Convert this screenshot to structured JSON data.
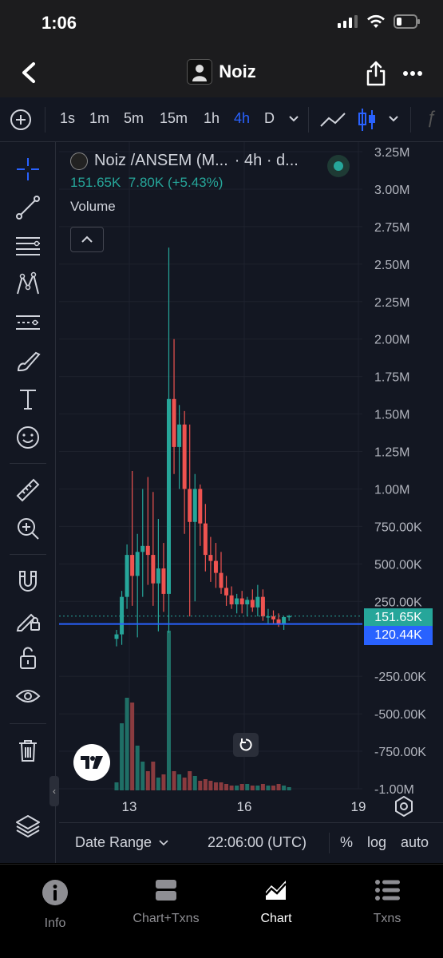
{
  "status": {
    "time": "1:06"
  },
  "nav": {
    "title": "Noiz",
    "back_icon": "chevron-left-icon",
    "share_icon": "share-icon",
    "more_icon": "more-icon"
  },
  "toolbar": {
    "intervals": [
      "1s",
      "1m",
      "5m",
      "15m",
      "1h",
      "4h",
      "D"
    ],
    "active_interval": "4h"
  },
  "legend": {
    "symbol": "Noiz /ANSEM (M...",
    "interval": "· 4h · d...",
    "price": "151.65K",
    "change": "7.80K (+5.43%)",
    "indicator": "Volume"
  },
  "price_axis": [
    "3.25M",
    "3.00M",
    "2.75M",
    "2.50M",
    "2.25M",
    "2.00M",
    "1.75M",
    "1.50M",
    "1.25M",
    "1.00M",
    "750.00K",
    "500.00K",
    "250.00K",
    "-250.00K",
    "-500.00K",
    "-750.00K",
    "-1.00M"
  ],
  "time_axis": [
    "13",
    "16",
    "19"
  ],
  "labels": {
    "current_price": "151.65K",
    "crosshair_price": "120.44K",
    "date_range": "Date Range",
    "utc_time": "22:06:00 (UTC)",
    "percent": "%",
    "log": "log",
    "auto": "auto"
  },
  "tabs": [
    {
      "label": "Info",
      "icon": "info-icon"
    },
    {
      "label": "Chart+Txns",
      "icon": "chart-txns-icon"
    },
    {
      "label": "Chart",
      "icon": "chart-icon",
      "active": true
    },
    {
      "label": "Txns",
      "icon": "list-icon"
    }
  ],
  "colors": {
    "up": "#26a69a",
    "down": "#ef5350",
    "accent": "#2962ff",
    "bg": "#131722"
  },
  "chart_data": {
    "type": "candlestick",
    "interval": "4h",
    "candles": [
      {
        "o": 0,
        "h": 60,
        "l": -50,
        "c": 30
      },
      {
        "o": 30,
        "h": 320,
        "l": -40,
        "c": 280
      },
      {
        "o": 280,
        "h": 630,
        "l": 200,
        "c": 560
      },
      {
        "o": 560,
        "h": 1120,
        "l": 220,
        "c": 420
      },
      {
        "o": 420,
        "h": 700,
        "l": 10,
        "c": 580
      },
      {
        "o": 580,
        "h": 1000,
        "l": 280,
        "c": 620
      },
      {
        "o": 620,
        "h": 1080,
        "l": 360,
        "c": 560
      },
      {
        "o": 560,
        "h": 980,
        "l": 220,
        "c": 370
      },
      {
        "o": 370,
        "h": 800,
        "l": 50,
        "c": 470
      },
      {
        "o": 470,
        "h": 640,
        "l": 180,
        "c": 300
      },
      {
        "o": 300,
        "h": 2610,
        "l": 40,
        "c": 1600
      },
      {
        "o": 1600,
        "h": 2000,
        "l": 1100,
        "c": 1280
      },
      {
        "o": 1280,
        "h": 1560,
        "l": 1000,
        "c": 1430
      },
      {
        "o": 1430,
        "h": 1520,
        "l": 700,
        "c": 1000
      },
      {
        "o": 1000,
        "h": 1430,
        "l": 150,
        "c": 780
      },
      {
        "o": 780,
        "h": 1100,
        "l": 250,
        "c": 1000
      },
      {
        "o": 1000,
        "h": 1030,
        "l": 620,
        "c": 770
      },
      {
        "o": 770,
        "h": 900,
        "l": 450,
        "c": 560
      },
      {
        "o": 560,
        "h": 680,
        "l": 380,
        "c": 520
      },
      {
        "o": 520,
        "h": 640,
        "l": 340,
        "c": 440
      },
      {
        "o": 440,
        "h": 580,
        "l": 300,
        "c": 340
      },
      {
        "o": 340,
        "h": 420,
        "l": 220,
        "c": 290
      },
      {
        "o": 290,
        "h": 350,
        "l": 200,
        "c": 230
      },
      {
        "o": 230,
        "h": 300,
        "l": 170,
        "c": 270
      },
      {
        "o": 270,
        "h": 320,
        "l": 170,
        "c": 230
      },
      {
        "o": 230,
        "h": 280,
        "l": 150,
        "c": 260
      },
      {
        "o": 260,
        "h": 330,
        "l": 180,
        "c": 210
      },
      {
        "o": 210,
        "h": 360,
        "l": 150,
        "c": 280
      },
      {
        "o": 280,
        "h": 330,
        "l": 120,
        "c": 150
      },
      {
        "o": 150,
        "h": 200,
        "l": 100,
        "c": 150
      },
      {
        "o": 150,
        "h": 190,
        "l": 100,
        "c": 130
      },
      {
        "o": 130,
        "h": 170,
        "l": 80,
        "c": 100
      },
      {
        "o": 100,
        "h": 150,
        "l": 60,
        "c": 145
      },
      {
        "o": 145,
        "h": 160,
        "l": 120,
        "c": 151.65
      }
    ],
    "volume_relative": [
      0.05,
      0.42,
      0.58,
      0.55,
      0.28,
      0.18,
      0.12,
      0.18,
      0.08,
      0.1,
      1.0,
      0.12,
      0.1,
      0.08,
      0.12,
      0.09,
      0.06,
      0.07,
      0.06,
      0.05,
      0.05,
      0.04,
      0.03,
      0.03,
      0.04,
      0.04,
      0.03,
      0.03,
      0.04,
      0.03,
      0.03,
      0.04,
      0.03,
      0.02
    ],
    "y_range": [
      -1000,
      3250
    ],
    "y_unit": "K",
    "x_ticks": [
      "13",
      "16",
      "19"
    ],
    "current_price": "151.65K",
    "crosshair_price": "120.44K"
  }
}
